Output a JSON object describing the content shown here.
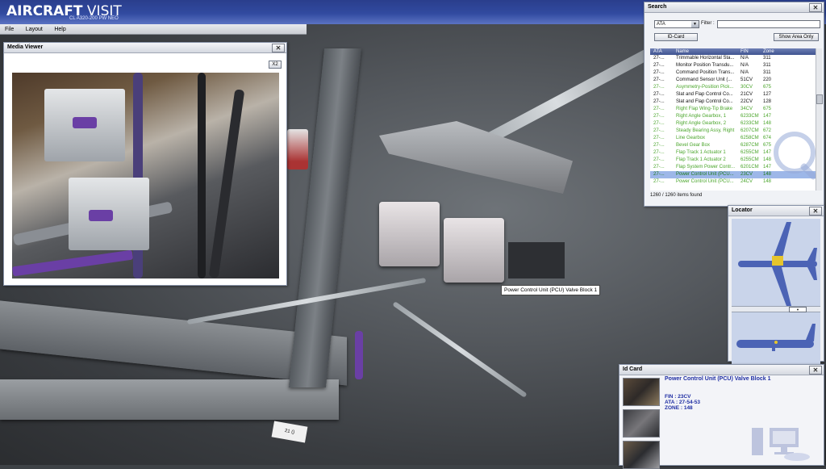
{
  "app": {
    "title_bold": "AIRCRAFT",
    "title_thin": " VISIT",
    "subtitle": "CL A320-200 PW NEO"
  },
  "menu": [
    "File",
    "Layout",
    "Help"
  ],
  "media_viewer": {
    "title": "Media Viewer",
    "zoom_label": "X2"
  },
  "search": {
    "title": "Search",
    "filter_type": "ATA",
    "filter_label": "Filter :",
    "filter_value": "",
    "idcard_button": "ID-Card",
    "show_area_button": "Show Area Only",
    "columns": [
      "ATA",
      "Name",
      "FIN",
      "Zone"
    ],
    "rows": [
      {
        "ata": "27-...",
        "name": "Trimmable Horizontal Sta...",
        "fin": "N/A",
        "zone": "311",
        "style": "normal"
      },
      {
        "ata": "27-...",
        "name": "Monitor Position Transdu...",
        "fin": "N/A",
        "zone": "311",
        "style": "normal"
      },
      {
        "ata": "27-...",
        "name": "Command Position Trans...",
        "fin": "N/A",
        "zone": "311",
        "style": "normal"
      },
      {
        "ata": "27-...",
        "name": "Command Sensor Unit (...",
        "fin": "51CV",
        "zone": "220",
        "style": "normal"
      },
      {
        "ata": "27-...",
        "name": "Asymmetry-Position Pick...",
        "fin": "30CV",
        "zone": "675",
        "style": "green"
      },
      {
        "ata": "27-...",
        "name": "Slat and Flap Control Co...",
        "fin": "21CV",
        "zone": "127",
        "style": "normal"
      },
      {
        "ata": "27-...",
        "name": "Slat and Flap Control Co...",
        "fin": "22CV",
        "zone": "128",
        "style": "normal"
      },
      {
        "ata": "27-...",
        "name": "Right Flap Wing-Tip Brake",
        "fin": "34CV",
        "zone": "675",
        "style": "green"
      },
      {
        "ata": "27-...",
        "name": "Right Angle Gearbox, 1",
        "fin": "6233CM",
        "zone": "147",
        "style": "green"
      },
      {
        "ata": "27-...",
        "name": "Right Angle Gearbox, 2",
        "fin": "6233CM",
        "zone": "148",
        "style": "green"
      },
      {
        "ata": "27-...",
        "name": "Steady Bearing Assy, Right",
        "fin": "6207CM",
        "zone": "672",
        "style": "green"
      },
      {
        "ata": "27-...",
        "name": "Line Gearbox",
        "fin": "6258CM",
        "zone": "674",
        "style": "green"
      },
      {
        "ata": "27-...",
        "name": "Bevel Gear Box",
        "fin": "6287CM",
        "zone": "675",
        "style": "green"
      },
      {
        "ata": "27-...",
        "name": "Flap Track 1 Actuator 1",
        "fin": "6255CM",
        "zone": "147",
        "style": "green"
      },
      {
        "ata": "27-...",
        "name": "Flap Track 1 Actuator 2",
        "fin": "6255CM",
        "zone": "148",
        "style": "green"
      },
      {
        "ata": "27-...",
        "name": "Flap System Power Contr...",
        "fin": "6201CM",
        "zone": "147",
        "style": "green"
      },
      {
        "ata": "27-...",
        "name": "Power Control Unit (PCU...",
        "fin": "23CV",
        "zone": "148",
        "style": "selected"
      },
      {
        "ata": "27-...",
        "name": "Power Control Unit (PCU...",
        "fin": "24CV",
        "zone": "148",
        "style": "green"
      }
    ],
    "found_text": "1260 / 1260 items found"
  },
  "locator": {
    "title": "Locator"
  },
  "idcard": {
    "title": "Id Card",
    "name": "Power Control Unit (PCU) Valve Block 1",
    "fin": "FIN : 23CV",
    "ata": "ATA : 27-54-53",
    "zone": "ZONE : 148"
  },
  "tooltip": "Power Control Unit (PCU) Valve Block 1",
  "viewport_tag": "21 ()"
}
